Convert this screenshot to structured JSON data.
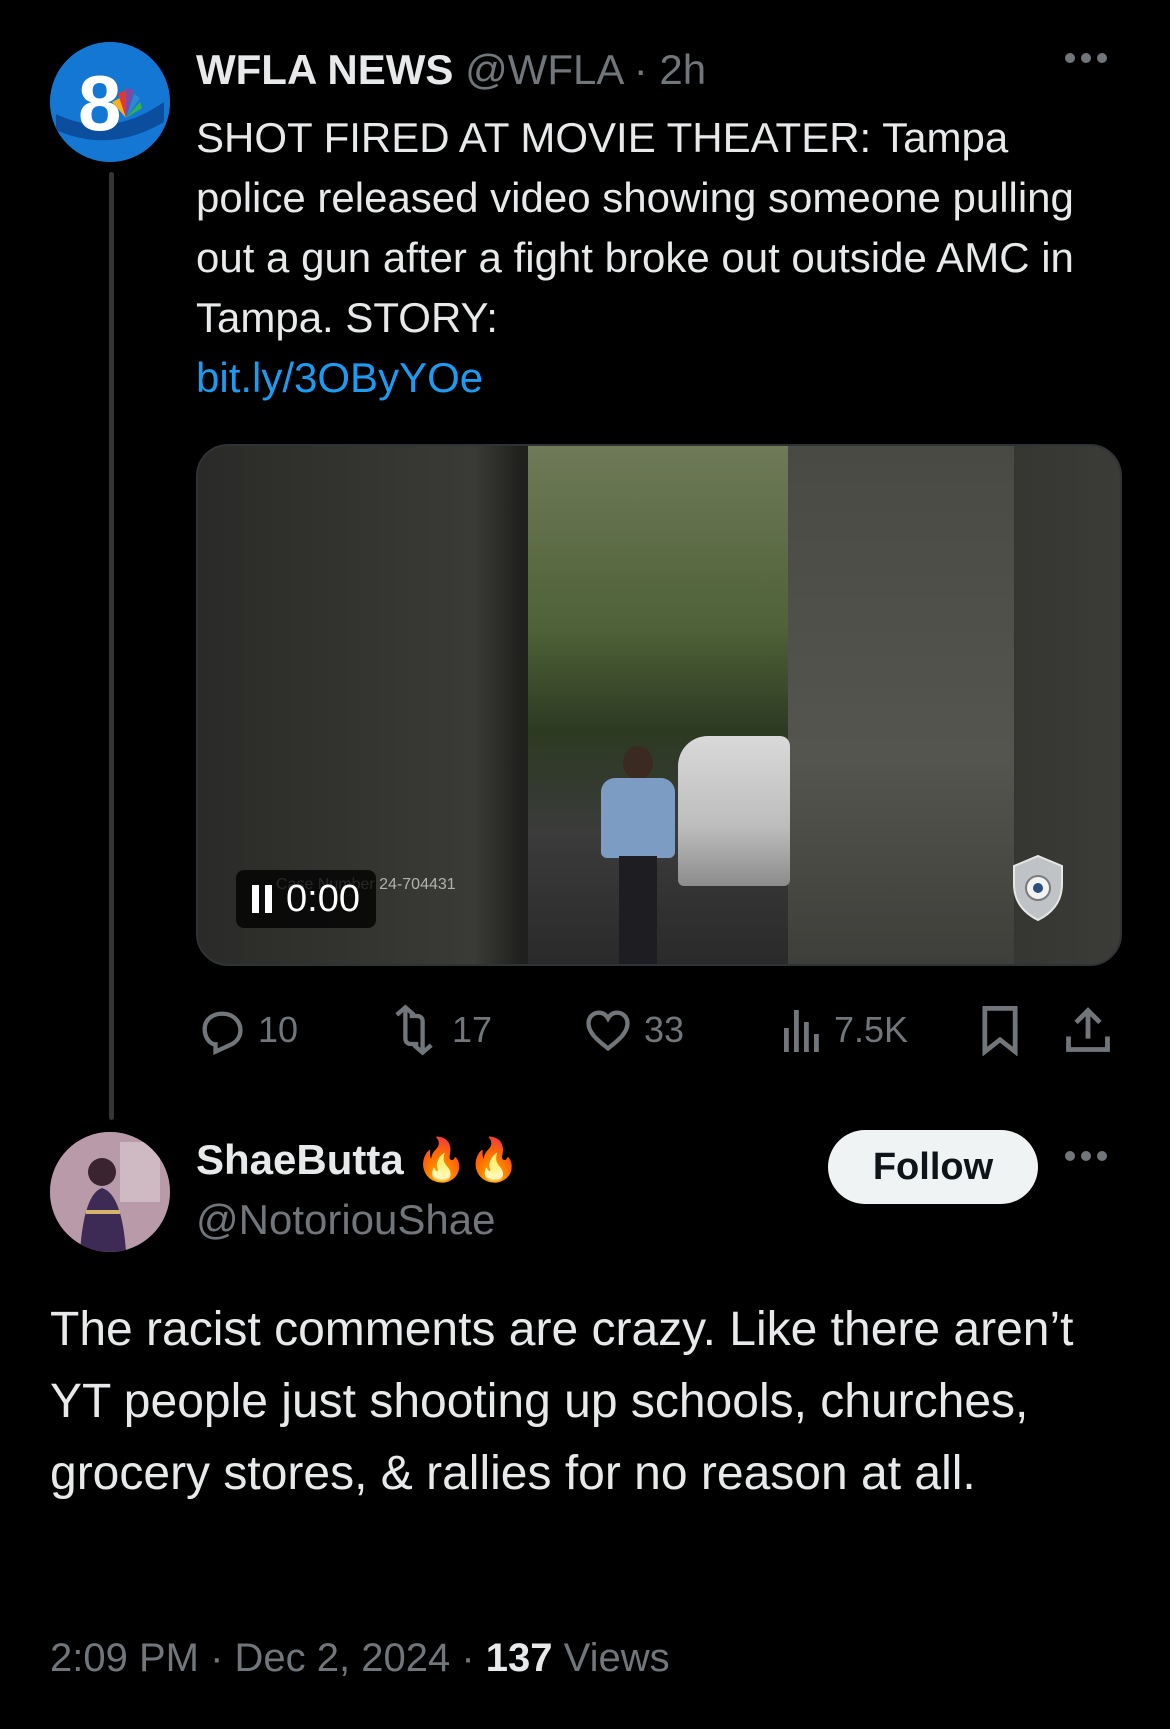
{
  "tweet1": {
    "author_name": "WFLA NEWS",
    "handle": "@WFLA",
    "separator": " · ",
    "time": "2h",
    "avatar_text": "8",
    "text_main": "SHOT FIRED AT MOVIE THEATER: Tampa police released video showing someone pulling out a gun after a fight broke out outside AMC in Tampa. STORY:",
    "link": "bit.ly/3OByYOe",
    "video": {
      "timer": "0:00",
      "case_text": "Case Number 24-704431"
    },
    "actions": {
      "replies": "10",
      "reposts": "17",
      "likes": "33",
      "views": "7.5K"
    }
  },
  "tweet2": {
    "author_name": "ShaeButta",
    "emoji": "🔥🔥",
    "handle": "@NotoriouShae",
    "follow_label": "Follow",
    "text": "The racist comments are crazy. Like there aren’t YT people just shooting up schools, churches, grocery stores, & rallies for no reason at all.",
    "time": "2:09 PM",
    "date": "Dec 2, 2024",
    "dot": " · ",
    "views_count": "137",
    "views_label": "Views"
  },
  "icons": {
    "more": "more-icon",
    "reply": "reply-icon",
    "repost": "repost-icon",
    "like": "heart-icon",
    "views": "views-icon",
    "bookmark": "bookmark-icon",
    "share": "share-icon",
    "pause": "pause-icon"
  },
  "colors": {
    "background": "#000000",
    "text": "#e7e9ea",
    "muted": "#71767b",
    "link": "#1d9bf0",
    "follow_bg": "#eff3f4"
  }
}
